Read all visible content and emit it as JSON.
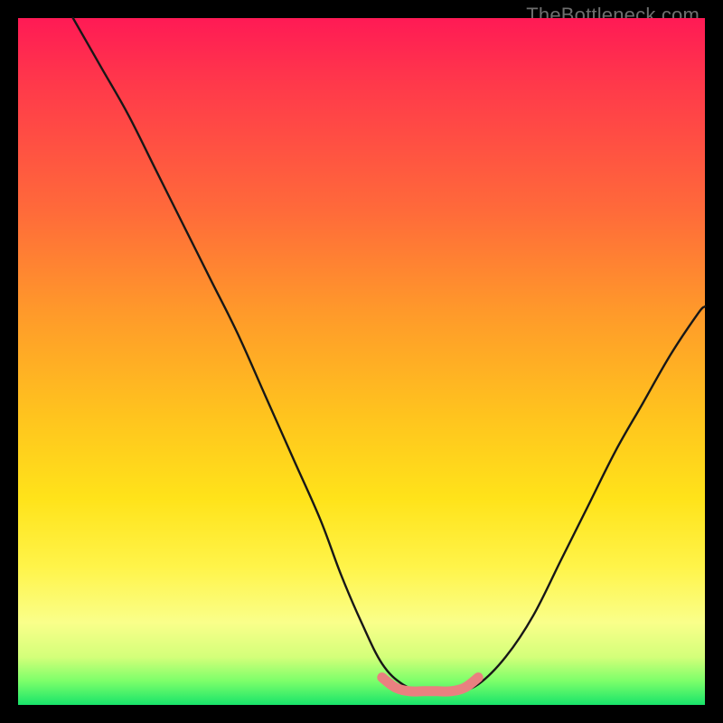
{
  "watermark": "TheBottleneck.com",
  "chart_data": {
    "type": "line",
    "title": "",
    "xlabel": "",
    "ylabel": "",
    "xlim": [
      0,
      100
    ],
    "ylim": [
      0,
      100
    ],
    "series": [
      {
        "name": "black-curve",
        "x": [
          8,
          12,
          16,
          20,
          24,
          28,
          32,
          36,
          40,
          44,
          47,
          50,
          53,
          56,
          59,
          62,
          64,
          67,
          71,
          75,
          79,
          83,
          87,
          91,
          95,
          99,
          100
        ],
        "values": [
          100,
          93,
          86,
          78,
          70,
          62,
          54,
          45,
          36,
          27,
          19,
          12,
          6,
          3,
          2,
          2,
          2,
          3,
          7,
          13,
          21,
          29,
          37,
          44,
          51,
          57,
          58
        ]
      },
      {
        "name": "pink-bottom-segment",
        "x": [
          53,
          55,
          57,
          59,
          61,
          63,
          65,
          67
        ],
        "values": [
          4,
          2.5,
          2,
          2,
          2,
          2,
          2.5,
          4
        ]
      }
    ]
  }
}
